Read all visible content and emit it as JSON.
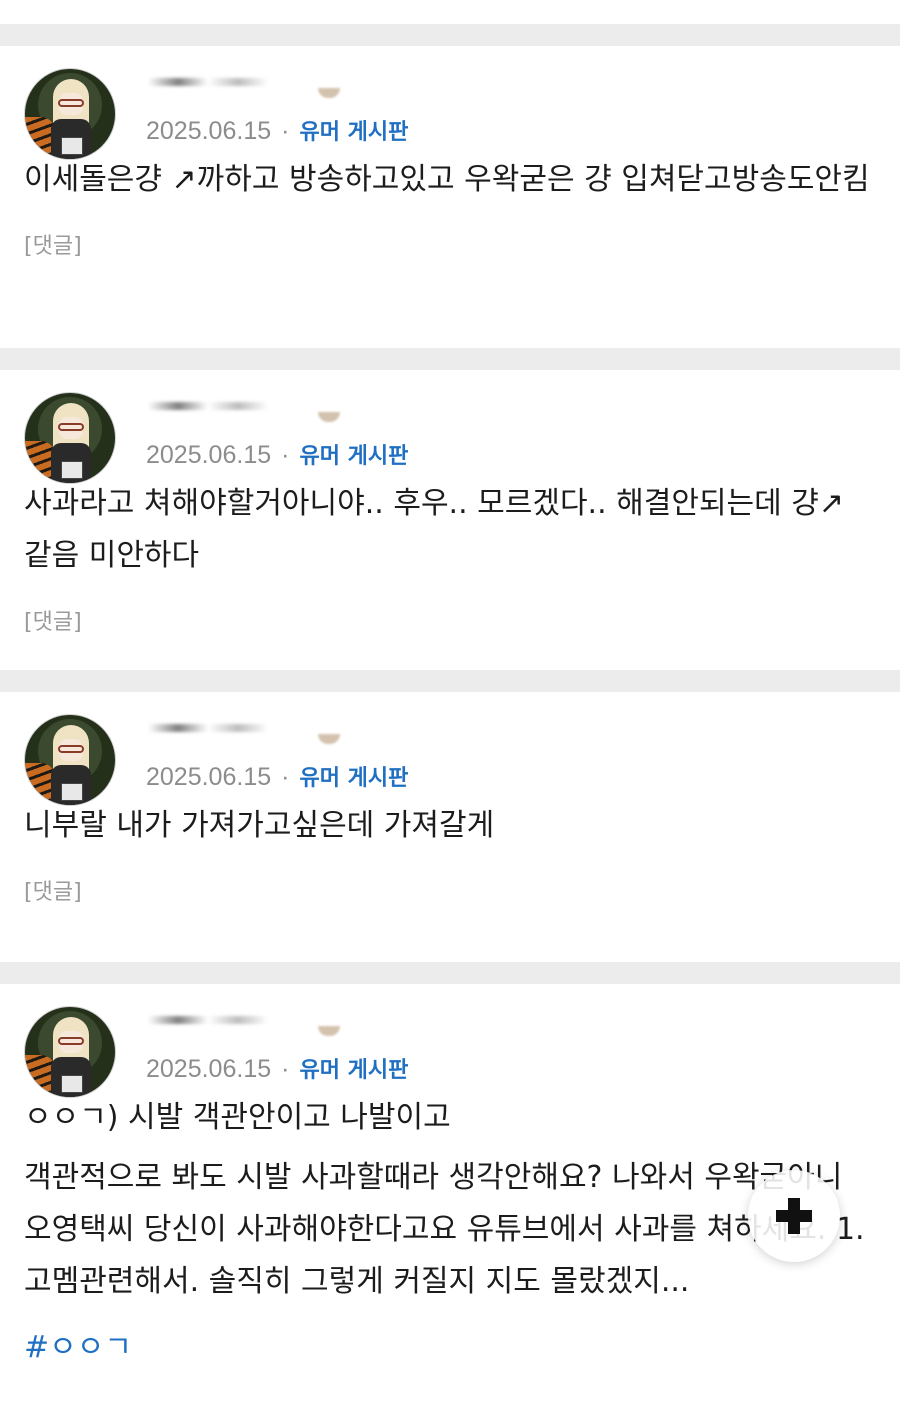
{
  "posts": [
    {
      "date": "2025.06.15",
      "separator": "·",
      "board": "유머 게시판",
      "text": "이세돌은걍 ↗까하고 방송하고있고 우왁굳은 걍 입쳐닫고방송도안킴",
      "reply_label": "[댓글]"
    },
    {
      "date": "2025.06.15",
      "separator": "·",
      "board": "유머 게시판",
      "text": "사과라고 쳐해야할거아니야.. 후우.. 모르겠다.. 해결안되는데 걍↗같음 미안하다",
      "reply_label": "[댓글]"
    },
    {
      "date": "2025.06.15",
      "separator": "·",
      "board": "유머 게시판",
      "text": "니부랄 내가 가져가고싶은데 가져갈게",
      "reply_label": "[댓글]"
    },
    {
      "date": "2025.06.15",
      "separator": "·",
      "board": "유머 게시판",
      "title_line": "ㅇㅇㄱ) 시발 객관안이고 나발이고",
      "text": "객관적으로 봐도 시발 사과할때라 생각안해요? 나와서 우왁굳아니 오영택씨 당신이 사과해야한다고요 유튜브에서 사과를 쳐하세요. 1.고멤관련해서. 솔직히 그렇게 커질지 지도 몰랐겠지...",
      "hashtag": "#ㅇㅇㄱ"
    }
  ],
  "fab": {
    "icon": "plus-icon"
  },
  "colors": {
    "board_link": "#1f6fc2",
    "meta_gray": "#8c8c8c",
    "divider": "#ececec"
  }
}
